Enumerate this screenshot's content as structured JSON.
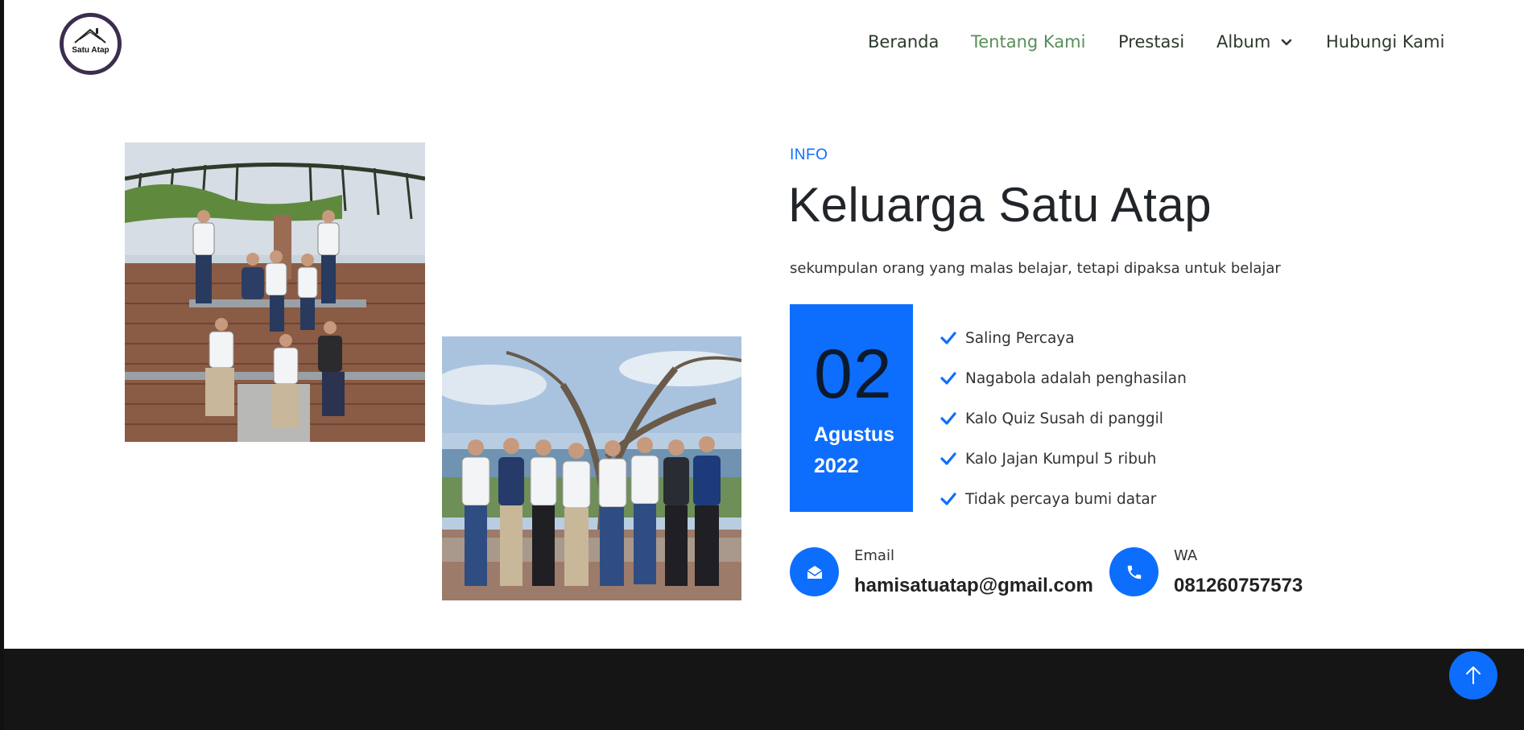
{
  "brand": {
    "logo_text": "Satu Atap"
  },
  "nav": {
    "items": [
      {
        "label": "Beranda",
        "active": false
      },
      {
        "label": "Tentang Kami",
        "active": true
      },
      {
        "label": "Prestasi",
        "active": false
      },
      {
        "label": "Album",
        "active": false,
        "dropdown": true
      },
      {
        "label": "Hubungi Kami",
        "active": false
      }
    ]
  },
  "about": {
    "eyebrow": "INFO",
    "title": "Keluarga Satu Atap",
    "subtitle": "sekumpulan orang yang malas belajar, tetapi dipaksa untuk belajar",
    "date": {
      "day": "02",
      "month": "Agustus",
      "year": "2022"
    },
    "features": [
      "Saling Percaya",
      "Nagabola adalah penghasilan",
      "Kalo Quiz Susah di panggil",
      "Kalo Jajan Kumpul 5 ribuh",
      "Tidak percaya bumi datar"
    ],
    "contacts": {
      "email": {
        "label": "Email",
        "value": "hamisatuatap@gmail.com",
        "icon": "envelope-open-icon"
      },
      "wa": {
        "label": "WA",
        "value": "081260757573",
        "icon": "phone-icon"
      }
    }
  },
  "colors": {
    "primary": "#0d6efd",
    "nav_active": "#5a8d5a",
    "nav_text": "#2c3a2b",
    "footer": "#151516"
  }
}
